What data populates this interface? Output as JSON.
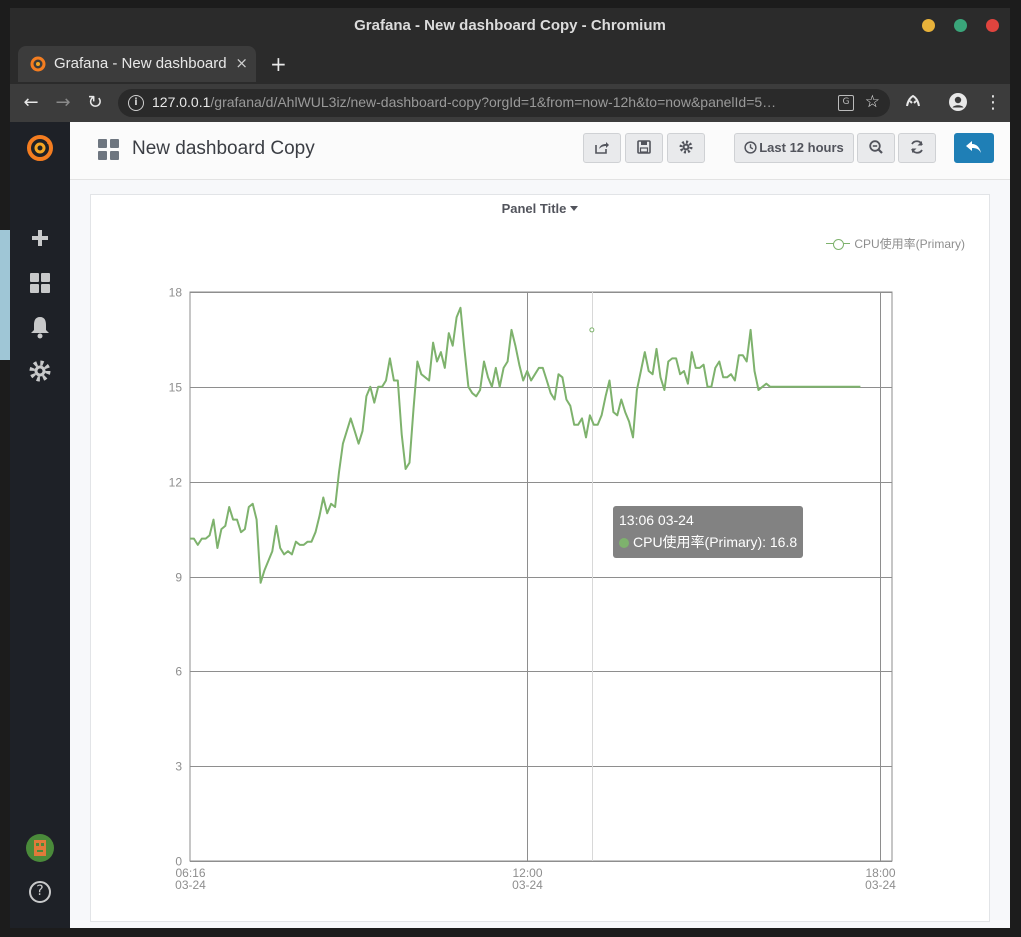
{
  "window": {
    "title": "Grafana - New dashboard Copy - Chromium",
    "controls": {
      "minimize_color": "#e8b23a",
      "maximize_color": "#3aa57a",
      "close_color": "#e0443e"
    }
  },
  "tab": {
    "title": "Grafana - New dashboard",
    "close": "×",
    "new_tab": "+"
  },
  "address": {
    "host": "127.0.0.1",
    "path": "/grafana/d/AhlWUL3iz/new-dashboard-copy?orgId=1&from=now-12h&to=now&panelId=5…"
  },
  "sidebar": {
    "items": [
      "grafana-logo-icon",
      "plus-icon",
      "dashboards-icon",
      "bell-icon",
      "gear-icon",
      "avatar",
      "help-icon"
    ],
    "help_label": "?"
  },
  "navbar": {
    "dashboard_title": "New dashboard Copy",
    "time_range": "Last 12 hours",
    "accent": "#1f7fb6"
  },
  "panel": {
    "title": "Panel Title",
    "legend": "CPU使用率(Primary)"
  },
  "tooltip": {
    "time": "13:06 03-24",
    "series": "CPU使用率(Primary)",
    "value": "16.8",
    "text": "CPU使用率(Primary): 16.8"
  },
  "chart_data": {
    "type": "line",
    "title": "Panel Title",
    "ylim": [
      0,
      18
    ],
    "yticks": [
      "0",
      "3",
      "6",
      "9",
      "12",
      "15",
      "18"
    ],
    "xticks": [
      {
        "time": "06:16",
        "date": "03-24"
      },
      {
        "time": "12:00",
        "date": "03-24"
      },
      {
        "time": "18:00",
        "date": "03-24"
      }
    ],
    "xrange_minutes": [
      376,
      1080
    ],
    "series": [
      {
        "name": "CPU使用率(Primary)",
        "color": "#7eb26d",
        "x_minutes": [
          376,
          380,
          384,
          388,
          392,
          396,
          400,
          404,
          408,
          412,
          416,
          420,
          424,
          428,
          432,
          436,
          440,
          444,
          448,
          452,
          456,
          460,
          464,
          468,
          472,
          476,
          480,
          484,
          488,
          492,
          496,
          500,
          504,
          508,
          512,
          516,
          520,
          524,
          528,
          532,
          536,
          540,
          544,
          548,
          552,
          556,
          560,
          564,
          568,
          572,
          576,
          580,
          584,
          588,
          592,
          596,
          600,
          604,
          608,
          612,
          616,
          620,
          624,
          628,
          632,
          636,
          640,
          644,
          648,
          652,
          656,
          660,
          664,
          668,
          672,
          676,
          680,
          684,
          688,
          692,
          696,
          700,
          704,
          708,
          712,
          716,
          720,
          724,
          728,
          732,
          736,
          740,
          744,
          748,
          752,
          756,
          760,
          764,
          768,
          772,
          776,
          780,
          784,
          788,
          792,
          796,
          800,
          804,
          808,
          812,
          816,
          820,
          824,
          828,
          832,
          836,
          840,
          844,
          848,
          852,
          856,
          860,
          864,
          868,
          872,
          876,
          880,
          884,
          888,
          892,
          896,
          900,
          904,
          908,
          912,
          916,
          920,
          924,
          928,
          932,
          936,
          940,
          944,
          948,
          952,
          956,
          960,
          964,
          968,
          972,
          976,
          980,
          984,
          988,
          992,
          996,
          1000,
          1004,
          1008,
          1012,
          1016,
          1020,
          1024,
          1028,
          1032,
          1036,
          1040,
          1044,
          1048,
          1052,
          1056,
          1060,
          1064,
          1068,
          1072,
          1076,
          1080,
          1084,
          1088,
          1092
        ],
        "values": [
          10.2,
          10.2,
          10.0,
          10.2,
          10.2,
          10.3,
          10.8,
          9.9,
          10.5,
          10.6,
          11.2,
          10.8,
          10.8,
          10.4,
          10.5,
          11.2,
          11.3,
          10.8,
          8.8,
          9.2,
          9.5,
          9.8,
          10.6,
          9.9,
          9.7,
          9.8,
          9.7,
          10.1,
          10.0,
          10.0,
          10.1,
          10.1,
          10.4,
          10.9,
          11.5,
          11.0,
          11.3,
          11.2,
          12.3,
          13.2,
          13.6,
          14.0,
          13.6,
          13.2,
          13.6,
          14.7,
          15.0,
          14.5,
          15.0,
          15.0,
          15.2,
          15.9,
          15.2,
          15.2,
          13.5,
          12.4,
          12.6,
          14.3,
          15.8,
          15.4,
          15.3,
          15.2,
          16.4,
          15.8,
          16.1,
          15.6,
          16.7,
          16.3,
          17.2,
          17.5,
          16.2,
          15.0,
          14.8,
          14.7,
          14.9,
          15.8,
          15.3,
          15.0,
          15.6,
          15.0,
          15.6,
          15.8,
          16.8,
          16.3,
          15.7,
          15.2,
          15.5,
          15.2,
          15.4,
          15.6,
          15.6,
          15.2,
          14.8,
          14.6,
          15.4,
          15.3,
          14.6,
          14.4,
          13.8,
          13.8,
          14.0,
          13.4,
          14.1,
          13.8,
          13.8,
          14.1,
          14.7,
          15.2,
          14.2,
          14.1,
          14.6,
          14.2,
          13.9,
          13.4,
          14.9,
          15.5,
          16.1,
          15.5,
          15.4,
          16.2,
          15.3,
          14.9,
          15.8,
          15.9,
          15.9,
          15.4,
          15.5,
          15.1,
          16.1,
          15.6,
          15.6,
          15.7,
          15.0,
          15.0,
          15.6,
          15.8,
          15.3,
          15.3,
          15.4,
          15.2,
          16.0,
          16.0,
          15.8,
          16.8,
          15.5,
          14.9,
          15.0,
          15.1,
          15.0,
          15.0,
          15.0,
          15.0,
          15.0,
          15.0,
          15.0,
          15.0,
          15.0,
          15.0,
          15.0,
          15.0,
          15.0,
          15.0,
          15.0,
          15.0,
          15.0,
          15.0,
          15.0,
          15.0,
          15.0,
          15.0,
          15.0,
          15.0
        ]
      }
    ]
  }
}
